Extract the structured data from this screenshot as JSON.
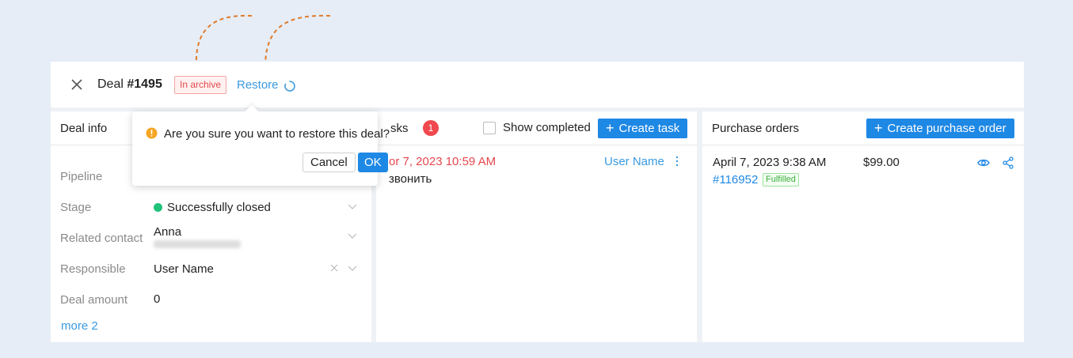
{
  "header": {
    "deal_prefix": "Deal ",
    "deal_number": "#1495",
    "archive_badge": "In archive",
    "restore_label": "Restore"
  },
  "deal_info": {
    "title": "Deal info",
    "fields": [
      {
        "label": "Pipeline",
        "value": ""
      },
      {
        "label": "Stage",
        "value": "Successfully closed"
      },
      {
        "label": "Related contact",
        "value": "Anna"
      },
      {
        "label": "Responsible",
        "value": "User Name"
      },
      {
        "label": "Deal amount",
        "value": "0"
      }
    ],
    "more_link": "more 2"
  },
  "tasks": {
    "title_partial": "sks",
    "count": "1",
    "show_completed": "Show completed",
    "create_task": "Create task",
    "items": [
      {
        "date": "or 7, 2023 10:59 AM",
        "text": "звонить",
        "user": "User Name"
      }
    ]
  },
  "purchase_orders": {
    "title": "Purchase orders",
    "create_label": "Create purchase order",
    "items": [
      {
        "date": "April 7, 2023 9:38 AM",
        "amount": "$99.00",
        "number": "#116952",
        "status": "Fulfilled"
      }
    ]
  },
  "popover": {
    "message": "Are you sure you want to restore this deal?",
    "cancel_label": "Cancel",
    "ok_label": "OK"
  },
  "colors": {
    "accent": "#1e88e5",
    "link": "#3a9ae0",
    "danger": "#e5484d",
    "success": "#21c27a",
    "annotation": "#e07b2a"
  }
}
